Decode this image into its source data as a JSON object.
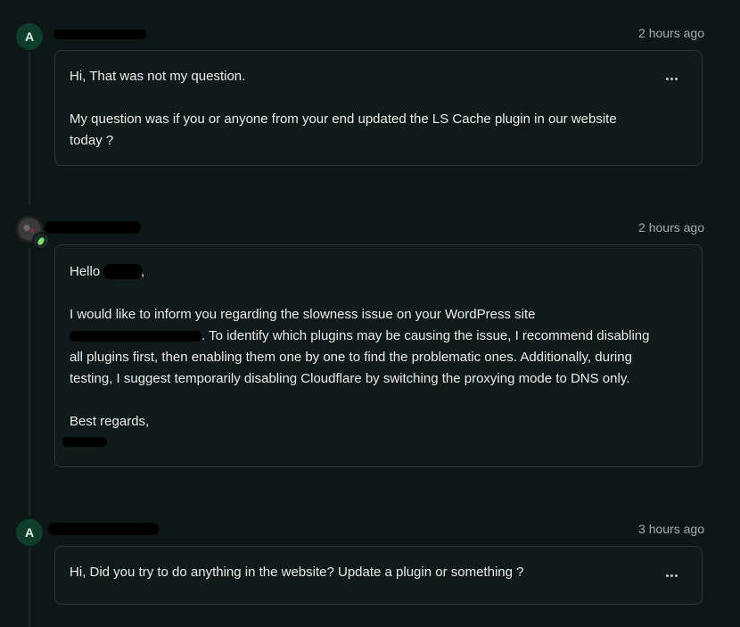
{
  "messages": [
    {
      "avatar_initial": "A",
      "time": "2 hours ago",
      "paragraphs": [
        "Hi, That was not my question.",
        "My question was if you or anyone from your end updated the LS Cache plugin in our website",
        "today ?"
      ],
      "menu_icon": "more-horizontal-icon"
    },
    {
      "avatar_initial": "",
      "time": "2 hours ago",
      "greeting": "Hello",
      "greeting_suffix": ",",
      "body_line1": "I would like to inform you regarding the slowness issue on your WordPress site",
      "body_line2_after_redaction": ". To identify which plugins may be causing the issue, I recommend disabling",
      "body_line3": "all plugins first, then enabling them one by one to find the problematic ones. Additionally, during",
      "body_line4": "testing, I suggest temporarily disabling Cloudflare by switching the proxying mode to DNS only.",
      "signoff": "Best regards,"
    },
    {
      "avatar_initial": "A",
      "time": "3 hours ago",
      "text": "Hi, Did you try to do anything in the website? Update a plugin or something ?",
      "menu_icon": "more-horizontal-icon"
    }
  ],
  "colors": {
    "background": "#0d1716",
    "card_border": "#2a3534",
    "avatar_bg": "#0f3d2c",
    "timestamp": "#a7adac",
    "presence_leaf": "#7be26a"
  }
}
